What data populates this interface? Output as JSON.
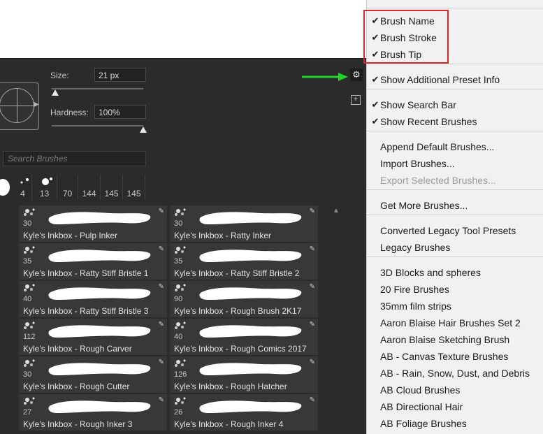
{
  "brush_settings": {
    "size_label": "Size:",
    "size_value": "21 px",
    "hardness_label": "Hardness:",
    "hardness_value": "100%",
    "size_slider_fraction": 0.04,
    "hardness_slider_fraction": 1.0
  },
  "search": {
    "placeholder": "Search Brushes"
  },
  "recent_brushes": [
    "4",
    "13",
    "70",
    "144",
    "145",
    "145"
  ],
  "brushes": [
    {
      "size": "30",
      "name": "Kyle's Inkbox - Pulp Inker"
    },
    {
      "size": "30",
      "name": "Kyle's Inkbox - Ratty Inker"
    },
    {
      "size": "35",
      "name": "Kyle's Inkbox - Ratty Stiff Bristle 1"
    },
    {
      "size": "35",
      "name": "Kyle's Inkbox - Ratty Stiff Bristle 2"
    },
    {
      "size": "40",
      "name": "Kyle's Inkbox - Ratty Stiff Bristle 3"
    },
    {
      "size": "90",
      "name": "Kyle's Inkbox - Rough Brush 2K17"
    },
    {
      "size": "112",
      "name": "Kyle's Inkbox - Rough Carver"
    },
    {
      "size": "40",
      "name": "Kyle's Inkbox - Rough Comics 2017"
    },
    {
      "size": "30",
      "name": "Kyle's Inkbox - Rough Cutter"
    },
    {
      "size": "126",
      "name": "Kyle's Inkbox - Rough Hatcher"
    },
    {
      "size": "27",
      "name": "Kyle's Inkbox - Rough Inker 3"
    },
    {
      "size": "26",
      "name": "Kyle's Inkbox - Rough Inker 4"
    }
  ],
  "icons": {
    "gear": "gear-icon",
    "new_preset": "new-preset-icon",
    "brush_edit": "brush-edit-icon",
    "scroll_up": "scroll-up-icon",
    "annotation_arrow": "green-arrow-icon",
    "checkmark": "checkmark-icon"
  },
  "menu": {
    "items": [
      {
        "label": "Brush Name",
        "checked": true
      },
      {
        "label": "Brush Stroke",
        "checked": true
      },
      {
        "label": "Brush Tip",
        "checked": true
      },
      {
        "label": "Show Additional Preset Info",
        "checked": true
      },
      {
        "label": "Show Search Bar",
        "checked": true
      },
      {
        "label": "Show Recent Brushes",
        "checked": true
      },
      {
        "label": "Append Default Brushes...",
        "checked": false
      },
      {
        "label": "Import Brushes...",
        "checked": false
      },
      {
        "label": "Export Selected Brushes...",
        "checked": false,
        "disabled": true
      },
      {
        "label": "Get More Brushes...",
        "checked": false
      },
      {
        "label": "Converted Legacy Tool Presets",
        "checked": false
      },
      {
        "label": "Legacy Brushes",
        "checked": false
      },
      {
        "label": "3D Blocks and spheres",
        "checked": false
      },
      {
        "label": "20 Fire Brushes",
        "checked": false
      },
      {
        "label": "35mm film strips",
        "checked": false
      },
      {
        "label": "Aaron Blaise Hair Brushes Set 2",
        "checked": false
      },
      {
        "label": "Aaron Blaise Sketching Brush",
        "checked": false
      },
      {
        "label": "AB - Canvas Texture Brushes",
        "checked": false
      },
      {
        "label": "AB - Rain, Snow, Dust, and Debris",
        "checked": false
      },
      {
        "label": "AB Cloud Brushes",
        "checked": false
      },
      {
        "label": "AB Directional Hair",
        "checked": false
      },
      {
        "label": "AB Foliage Brushes",
        "checked": false
      }
    ]
  },
  "colors": {
    "panel_bg": "#2b2b2b",
    "menu_bg": "#f1f1f1",
    "highlight_box": "#d9262b",
    "annotation_arrow": "#22d12a"
  }
}
